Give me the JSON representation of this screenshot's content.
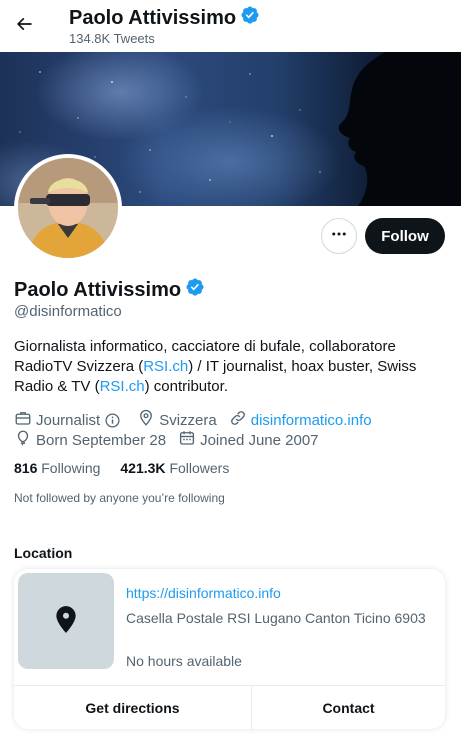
{
  "header": {
    "title": "Paolo Attivissimo",
    "tweet_count": "134.8K Tweets"
  },
  "profile": {
    "display_name": "Paolo Attivissimo",
    "handle": "@disinformatico",
    "bio": {
      "part1": "Giornalista informatico, cacciatore di bufale, collaboratore RadioTV Svizzera (",
      "link1": "RSI.ch",
      "part2": ") / IT journalist, hoax buster, Swiss Radio & TV (",
      "link2": "RSI.ch",
      "part3": ") contributor."
    },
    "category": "Journalist",
    "location": "Svizzera",
    "website": "disinformatico.info",
    "born": "Born September 28",
    "joined": "Joined June 2007",
    "following_count": "816",
    "following_label": "Following",
    "followers_count": "421.3K",
    "followers_label": "Followers",
    "not_followed_text": "Not followed by anyone you’re following"
  },
  "actions": {
    "follow_label": "Follow"
  },
  "location_section": {
    "heading": "Location",
    "url": "https://disinformatico.info",
    "address": "Casella Postale RSI Lugano Canton Ticino 6903",
    "hours": "No hours available",
    "directions_label": "Get directions",
    "contact_label": "Contact"
  },
  "colors": {
    "accent": "#1d9bf0",
    "text_primary": "#0f1419",
    "text_secondary": "#536471",
    "follow_button": "#0f1419"
  },
  "icons": [
    "back-arrow-icon",
    "verified-badge-icon",
    "more-icon",
    "briefcase-icon",
    "info-icon",
    "location-pin-icon",
    "link-icon",
    "balloon-icon",
    "calendar-icon",
    "map-pin-icon"
  ]
}
